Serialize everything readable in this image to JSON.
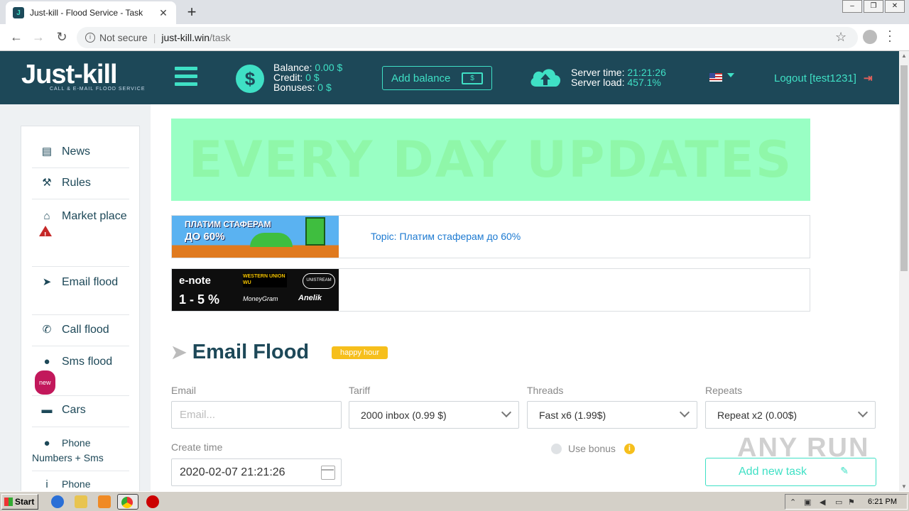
{
  "browser": {
    "tab_title": "Just-kill - Flood Service - Task",
    "tab_close": "✕",
    "new_tab": "+",
    "not_secure": "Not secure",
    "url_host": "just-kill.win",
    "url_path": "/task",
    "window_controls": [
      "‒",
      "❐",
      "✕"
    ]
  },
  "header": {
    "logo_main": "Just-kill",
    "logo_sub": "CALL & E-MAIL FLOOD SERVICE",
    "balance_label": "Balance:",
    "balance_value": "0.00 $",
    "credit_label": "Credit:",
    "credit_value": "0 $",
    "bonuses_label": "Bonuses:",
    "bonuses_value": "0 $",
    "add_balance": "Add balance",
    "server_time_label": "Server time:",
    "server_time_value": "21:21:26",
    "server_load_label": "Server load:",
    "server_load_value": "457.1%",
    "logout": "Logout [test1231]"
  },
  "sidebar": {
    "items": [
      {
        "label": "News",
        "icon": "newspaper-icon"
      },
      {
        "label": "Rules",
        "icon": "gavel-icon"
      },
      {
        "label": "Market place",
        "icon": "basket-icon"
      },
      {
        "label": "Email flood",
        "icon": "paper-plane-icon"
      },
      {
        "label": "Call flood",
        "icon": "phone-icon"
      },
      {
        "label": "Sms flood",
        "icon": "chat-icon",
        "badge": "new"
      },
      {
        "label": "Cars",
        "icon": "car-icon"
      },
      {
        "label": "Phone Numbers + Sms",
        "icon": "chat-icon"
      },
      {
        "label": "Phone",
        "icon": "info-icon"
      }
    ]
  },
  "banners": {
    "top_text": "EVERY DAY UPDATES",
    "ad1_line1": "ПЛАТИМ СТАФЕРАМ",
    "ad1_line2": "ДО 60%",
    "ad1_topic": "Topic: Платим стаферам до 60%",
    "ad2_brand": "e-note",
    "ad2_pct": "1 - 5 %",
    "ad2_wu": "WESTERN UNION WU",
    "ad2_unistream": "UNISTREAM",
    "ad2_moneygram": "MoneyGram",
    "ad2_anelik": "Anelik"
  },
  "form": {
    "title": "Email Flood",
    "happy_hour": "happy hour",
    "email_label": "Email",
    "email_placeholder": "Email...",
    "tariff_label": "Tariff",
    "tariff_value": "2000 inbox (0.99 $)",
    "threads_label": "Threads",
    "threads_value": "Fast x6 (1.99$)",
    "repeats_label": "Repeats",
    "repeats_value": "Repeat x2 (0.00$)",
    "create_time_label": "Create time",
    "create_time_value": "2020-02-07 21:21:26",
    "use_bonus": "Use bonus",
    "add_task": "Add new task"
  },
  "watermark": "ANY RUN",
  "taskbar": {
    "start": "Start",
    "clock": "6:21 PM"
  },
  "colors": {
    "header_bg": "#1d4858",
    "accent": "#3fe0c5",
    "banner_green": "#99ffc4",
    "happy_hour": "#f6bf1c",
    "logout_icon": "#e0605b"
  }
}
